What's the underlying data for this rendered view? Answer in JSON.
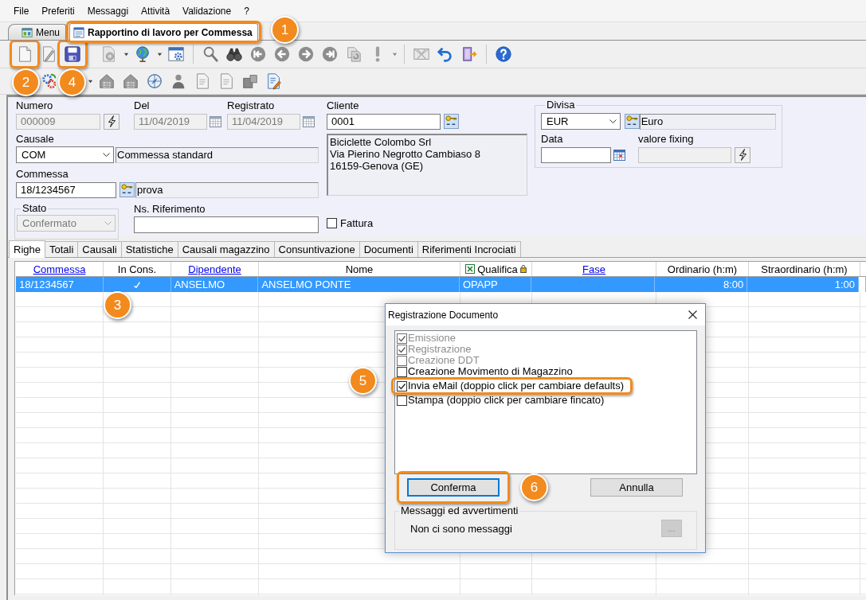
{
  "menu_bar": [
    "File",
    "Preferiti",
    "Messaggi",
    "Attività",
    "Validazione",
    "?"
  ],
  "document_tabs": [
    {
      "label": "Menu",
      "selected": false,
      "highlighted": false
    },
    {
      "label": "Rapportino di lavoro per Commessa",
      "selected": true,
      "highlighted": true
    }
  ],
  "toolbar": {
    "file_buttons": [
      {
        "highlighted": true
      },
      {
        "highlighted": false
      },
      {
        "highlighted": true
      }
    ]
  },
  "form": {
    "numero": {
      "label": "Numero",
      "value": "000009",
      "disabled": true
    },
    "del": {
      "label": "Del",
      "value": "11/04/2019",
      "disabled": true
    },
    "registrato": {
      "label": "Registrato",
      "value": "11/04/2019",
      "disabled": true
    },
    "cliente": {
      "label": "Cliente",
      "value": "0001",
      "address": [
        "Biciclette Colombo Srl",
        "Via Pierino Negrotto Cambiaso 8",
        "16159-Genova (GE)"
      ]
    },
    "causale": {
      "label": "Causale",
      "value": "COM",
      "description": "Commessa standard"
    },
    "commessa": {
      "label": "Commessa",
      "value": "18/1234567",
      "description": "prova"
    },
    "stato": {
      "label": "Stato",
      "value": "Confermato",
      "disabled": true
    },
    "ns_riferimento": {
      "label": "Ns. Riferimento"
    },
    "fattura": {
      "label": "Fattura",
      "checked": false
    },
    "divisa": {
      "label": "Divisa",
      "value": "EUR",
      "description": "Euro"
    },
    "data": {
      "label": "Data"
    },
    "valore_fixing": {
      "label": "valore fixing",
      "disabled": true
    }
  },
  "section_tabs": [
    {
      "label": "Righe",
      "selected": true
    },
    {
      "label": "Totali",
      "selected": false
    },
    {
      "label": "Causali",
      "selected": false
    },
    {
      "label": "Statistiche",
      "selected": false
    },
    {
      "label": "Causali magazzino",
      "selected": false
    },
    {
      "label": "Consuntivazione",
      "selected": false
    },
    {
      "label": "Documenti",
      "selected": false
    },
    {
      "label": "Riferimenti Incrociati",
      "selected": false
    }
  ],
  "table": {
    "columns": [
      {
        "label": "Commessa",
        "kind": "link"
      },
      {
        "label": "In Cons.",
        "kind": "plain"
      },
      {
        "label": "Dipendente",
        "kind": "link"
      },
      {
        "label": "Nome",
        "kind": "plain"
      },
      {
        "label": "Qualifica",
        "kind": "locked"
      },
      {
        "label": "Fase",
        "kind": "link"
      },
      {
        "label": "Ordinario (h:m)",
        "kind": "plain"
      },
      {
        "label": "Straordinario (h:m)",
        "kind": "plain"
      }
    ],
    "rows": [
      {
        "selected": true,
        "cells": [
          {
            "kind": "text",
            "text": "18/1234567"
          },
          {
            "kind": "check",
            "checked": true
          },
          {
            "kind": "text",
            "text": "ANSELMO"
          },
          {
            "kind": "text",
            "text": "ANSELMO PONTE"
          },
          {
            "kind": "text",
            "text": "OPAPP"
          },
          {
            "kind": "text"
          },
          {
            "kind": "number",
            "text": "8:00"
          },
          {
            "kind": "number",
            "text": "1:00"
          }
        ]
      }
    ]
  },
  "dialog": {
    "title": "Registrazione Documento",
    "options": [
      {
        "label": "Emissione",
        "checked": true,
        "disabled": true,
        "highlighted": false
      },
      {
        "label": "Registrazione",
        "checked": true,
        "disabled": true,
        "highlighted": false
      },
      {
        "label": "Creazione DDT",
        "checked": false,
        "disabled": true,
        "highlighted": false
      },
      {
        "label": "Creazione Movimento di Magazzino",
        "checked": false,
        "disabled": false,
        "highlighted": false
      },
      {
        "label": "Invia eMail (doppio click per cambiare defaults)",
        "checked": true,
        "disabled": false,
        "highlighted": true
      },
      {
        "label": "Stampa (doppio click per cambiare fincato)",
        "checked": false,
        "disabled": false,
        "highlighted": false
      }
    ],
    "buttons": [
      {
        "label": "Conferma",
        "focused": true,
        "highlighted": true
      },
      {
        "label": "Annulla",
        "focused": false,
        "highlighted": false
      }
    ],
    "messages": {
      "title": "Messaggi ed avvertimenti",
      "text": "Non ci sono messaggi",
      "more_button": {
        "label": "...",
        "disabled": true
      }
    }
  },
  "callouts": [
    "1",
    "2",
    "3",
    "4",
    "5",
    "6"
  ]
}
